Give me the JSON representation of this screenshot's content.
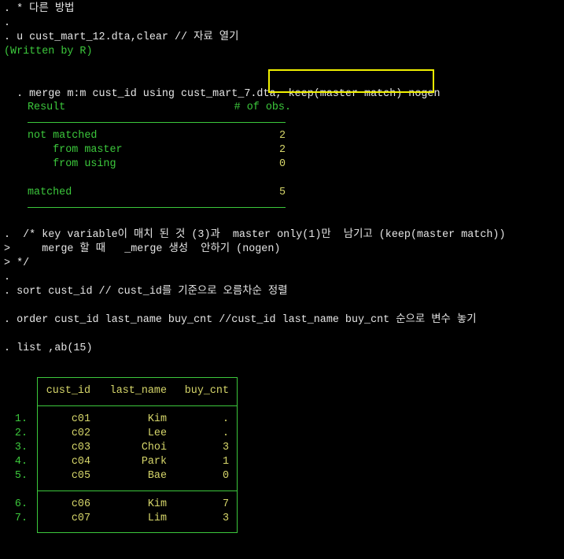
{
  "log": {
    "line1": ". * 다른 방법",
    "line2": ".",
    "line3": ". u cust_mart_12.dta,clear // 자료 열기",
    "written_by": "(Written by R)",
    "merge_prefix": ". merge m:m cust_id using cust_mart_7.dta, ",
    "merge_highlight": "keep(master match) nogen",
    "comment1": ".  /* key variable이 매치 된 것 (3)과  master only(1)만  남기고 (keep(master match))",
    "comment2": ">     merge 할 때   _merge 생성  안하기 (nogen)",
    "comment3": "> */",
    "dot": ".",
    "sort": ". sort cust_id // cust_id를 기준으로 오름차순 정렬",
    "order": ". order cust_id last_name buy_cnt //cust_id last_name buy_cnt 순으로 변수 놓기",
    "list": ". list ,ab(15)"
  },
  "merge_result": {
    "header_label": "Result",
    "header_count": "# of obs.",
    "rows": [
      {
        "label": "not matched",
        "value": "2"
      },
      {
        "label": "    from master",
        "value": "2"
      },
      {
        "label": "    from using",
        "value": "0"
      },
      {
        "label": "matched",
        "value": "5"
      }
    ]
  },
  "list_table": {
    "columns": [
      "cust_id",
      "last_name",
      "buy_cnt"
    ],
    "rows": [
      {
        "n": "1.",
        "cust_id": "c01",
        "last_name": "Kim",
        "buy_cnt": "."
      },
      {
        "n": "2.",
        "cust_id": "c02",
        "last_name": "Lee",
        "buy_cnt": "."
      },
      {
        "n": "3.",
        "cust_id": "c03",
        "last_name": "Choi",
        "buy_cnt": "3"
      },
      {
        "n": "4.",
        "cust_id": "c04",
        "last_name": "Park",
        "buy_cnt": "1"
      },
      {
        "n": "5.",
        "cust_id": "c05",
        "last_name": "Bae",
        "buy_cnt": "0"
      },
      {
        "n": "6.",
        "cust_id": "c06",
        "last_name": "Kim",
        "buy_cnt": "7"
      },
      {
        "n": "7.",
        "cust_id": "c07",
        "last_name": "Lim",
        "buy_cnt": "3"
      }
    ]
  },
  "colors": {
    "background": "#000000",
    "command_text": "#e6e6e6",
    "result_text": "#3cc83c",
    "value_text": "#d6d66a",
    "highlight_box": "#f0f000"
  }
}
